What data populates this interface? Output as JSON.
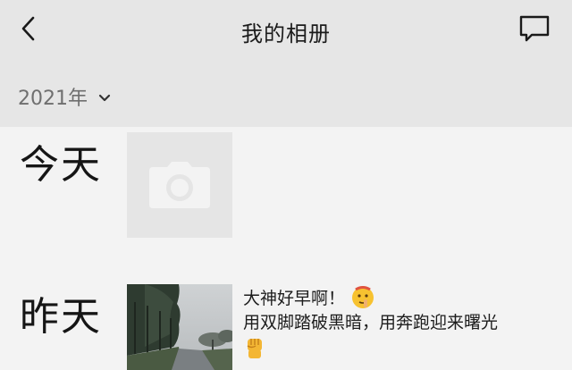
{
  "header": {
    "title": "我的相册",
    "back_icon": "chevron-left-icon",
    "message_icon": "comment-icon"
  },
  "year_selector": {
    "label": "2021年",
    "icon": "chevron-down-icon"
  },
  "timeline": [
    {
      "day": "今天",
      "item_type": "camera",
      "icon": "camera-icon"
    },
    {
      "day": "昨天",
      "item_type": "post",
      "text_line1": "大神好早啊！",
      "text_line2": "用双脚踏破黑暗，用奔跑迎来曙光",
      "emoji1": "shushing-face-emoji",
      "emoji2": "raised-fist-emoji"
    }
  ],
  "colors": {
    "header_bg": "#e6e6e6",
    "body_bg": "#f3f3f3",
    "camera_tile_bg": "#e5e5e5"
  }
}
